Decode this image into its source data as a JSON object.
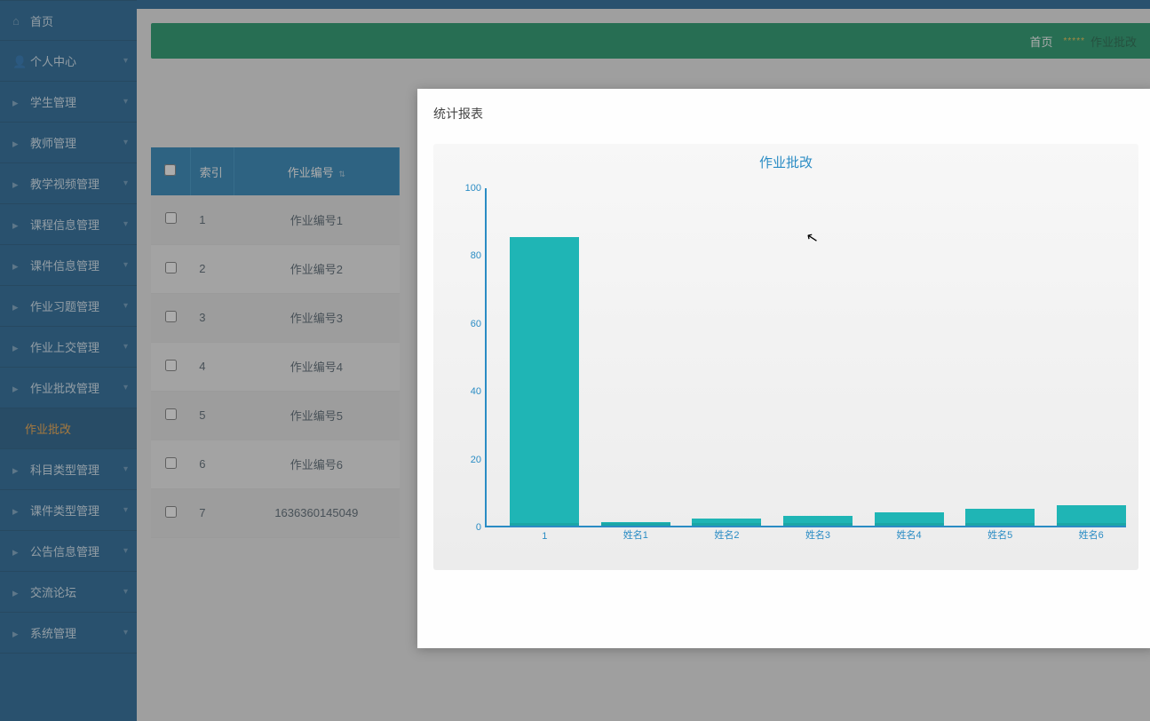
{
  "sidebar": {
    "items": [
      {
        "label": "首页",
        "has_chev": false
      },
      {
        "label": "个人中心",
        "has_chev": true
      },
      {
        "label": "学生管理",
        "has_chev": true
      },
      {
        "label": "教师管理",
        "has_chev": true
      },
      {
        "label": "教学视频管理",
        "has_chev": true
      },
      {
        "label": "课程信息管理",
        "has_chev": true
      },
      {
        "label": "课件信息管理",
        "has_chev": true
      },
      {
        "label": "作业习题管理",
        "has_chev": true
      },
      {
        "label": "作业上交管理",
        "has_chev": true
      },
      {
        "label": "作业批改管理",
        "has_chev": true
      },
      {
        "label": "作业批改",
        "sub": true
      },
      {
        "label": "科目类型管理",
        "has_chev": true
      },
      {
        "label": "课件类型管理",
        "has_chev": true
      },
      {
        "label": "公告信息管理",
        "has_chev": true
      },
      {
        "label": "交流论坛",
        "has_chev": true
      },
      {
        "label": "系统管理",
        "has_chev": true
      }
    ]
  },
  "breadcrumb": {
    "home": "首页",
    "sep": "*****",
    "current": "作业批改"
  },
  "table": {
    "headers": {
      "index": "索引",
      "code": "作业编号"
    },
    "rows": [
      {
        "idx": "1",
        "code": "作业编号1"
      },
      {
        "idx": "2",
        "code": "作业编号2"
      },
      {
        "idx": "3",
        "code": "作业编号3"
      },
      {
        "idx": "4",
        "code": "作业编号4"
      },
      {
        "idx": "5",
        "code": "作业编号5"
      },
      {
        "idx": "6",
        "code": "作业编号6"
      },
      {
        "idx": "7",
        "code": "1636360145049"
      }
    ]
  },
  "modal": {
    "title": "统计报表"
  },
  "chart_data": {
    "type": "bar",
    "title": "作业批改",
    "categories": [
      "1",
      "姓名1",
      "姓名2",
      "姓名3",
      "姓名4",
      "姓名5",
      "姓名6"
    ],
    "values": [
      85,
      1,
      2,
      3,
      4,
      5,
      6
    ],
    "ylim": [
      0,
      100
    ],
    "yticks": [
      0,
      20,
      40,
      60,
      80,
      100
    ],
    "xlabel": "",
    "ylabel": ""
  }
}
